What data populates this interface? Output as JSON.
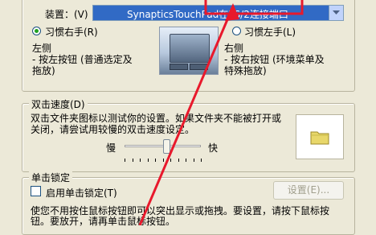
{
  "device": {
    "label": "装置：(V)",
    "selected_value": "SynapticsTouchPad在PS/2连接端口"
  },
  "handedness": {
    "right_handed_label": "习惯右手(R)",
    "left_handed_label": "习惯左手(L)",
    "selected": "right"
  },
  "left_button": {
    "title": "左侧",
    "line1": "- 按左按钮 (普通选定及",
    "line2": "拖放)"
  },
  "right_button": {
    "title": "右侧",
    "line1": "- 按右按钮 (环境菜单及",
    "line2": "特殊拖放)"
  },
  "double_click": {
    "group_title": "双击速度(D)",
    "line1": "双击文件夹图标以测试你的设置。如果文件夹不能被打开或",
    "line2": "关闭，请尝试用较慢的双击速度设定。",
    "slow_label": "慢",
    "fast_label": "快",
    "speed_fraction": 0.55
  },
  "click_lock": {
    "group_title": "单击锁定",
    "checkbox_label": "启用单击锁定(T)",
    "checked": false,
    "settings_button": "设置(E)...",
    "line1": "使您不用按住鼠标按钮即可以突出显示或拖拽。要设置，请按下鼠标按",
    "line2": "钮。要放开，请再单击鼠标按钮。"
  },
  "colors": {
    "selection_blue": "#316ac5",
    "annotation_red": "#e8192c",
    "window_bg": "#ece9d8"
  }
}
